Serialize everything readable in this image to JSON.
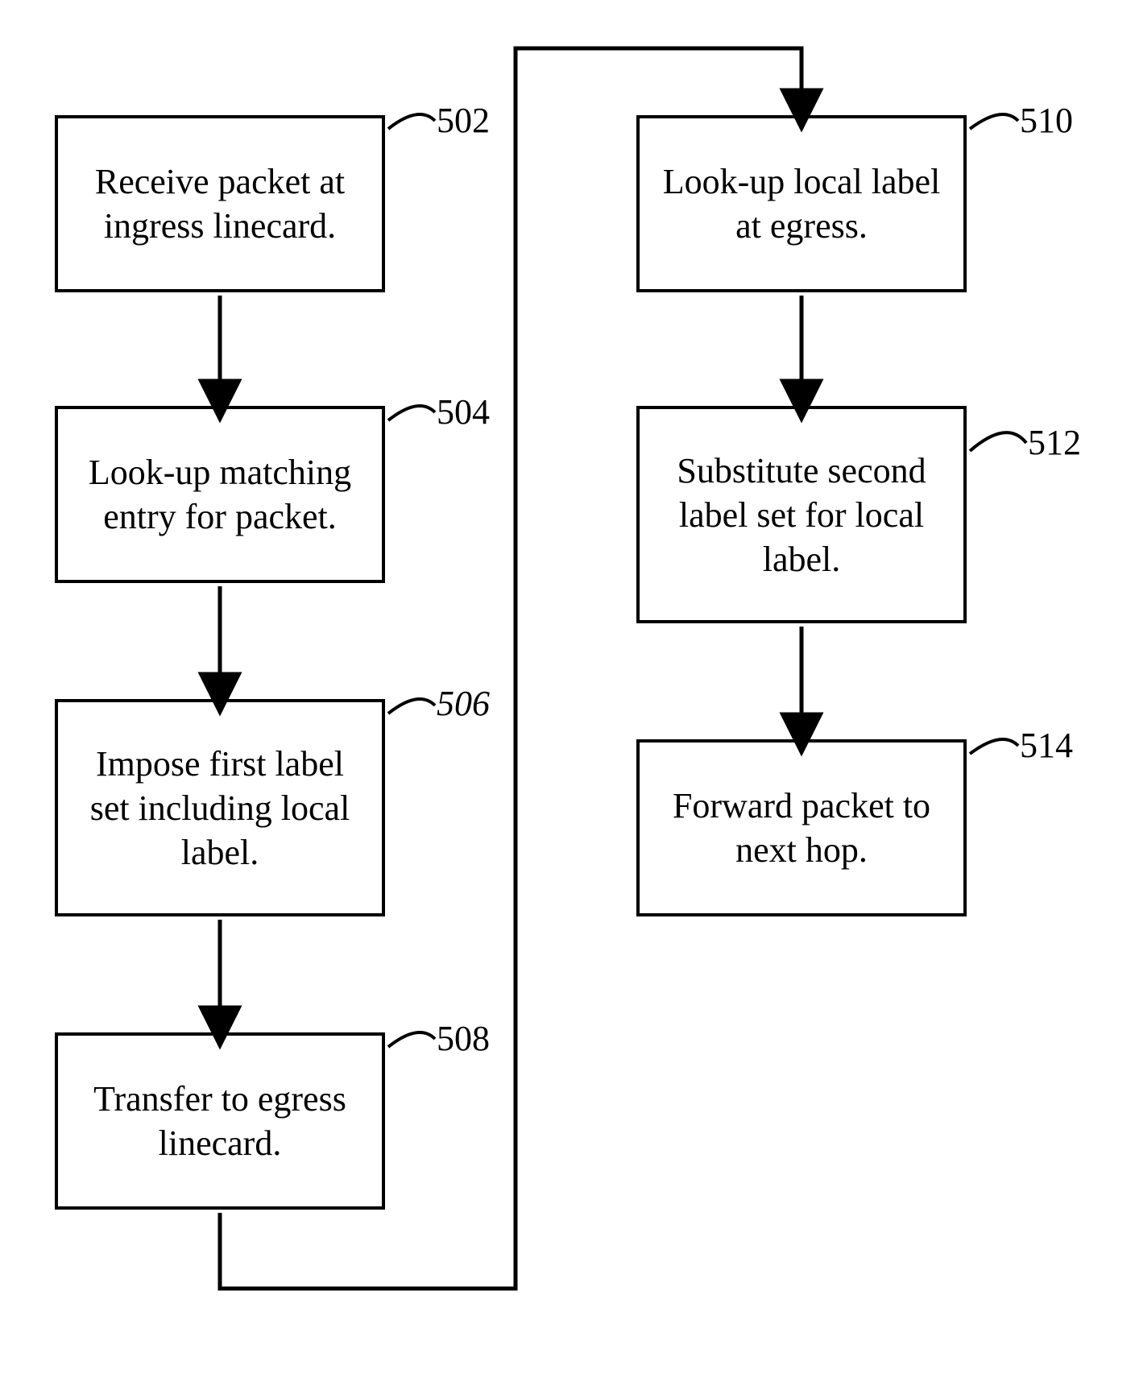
{
  "diagram": {
    "type": "flowchart",
    "steps": [
      {
        "id": "502",
        "text": "Receive packet at ingress linecard.",
        "ref": "502"
      },
      {
        "id": "504",
        "text": "Look-up matching entry for packet.",
        "ref": "504"
      },
      {
        "id": "506",
        "text": "Impose first label set including local label.",
        "ref": "506"
      },
      {
        "id": "508",
        "text": "Transfer to egress linecard.",
        "ref": "508"
      },
      {
        "id": "510",
        "text": "Look-up local label at egress.",
        "ref": "510"
      },
      {
        "id": "512",
        "text": "Substitute second label set for local label.",
        "ref": "512"
      },
      {
        "id": "514",
        "text": "Forward packet to next hop.",
        "ref": "514"
      }
    ],
    "edges": [
      [
        "502",
        "504"
      ],
      [
        "504",
        "506"
      ],
      [
        "506",
        "508"
      ],
      [
        "508",
        "510"
      ],
      [
        "510",
        "512"
      ],
      [
        "512",
        "514"
      ]
    ]
  }
}
